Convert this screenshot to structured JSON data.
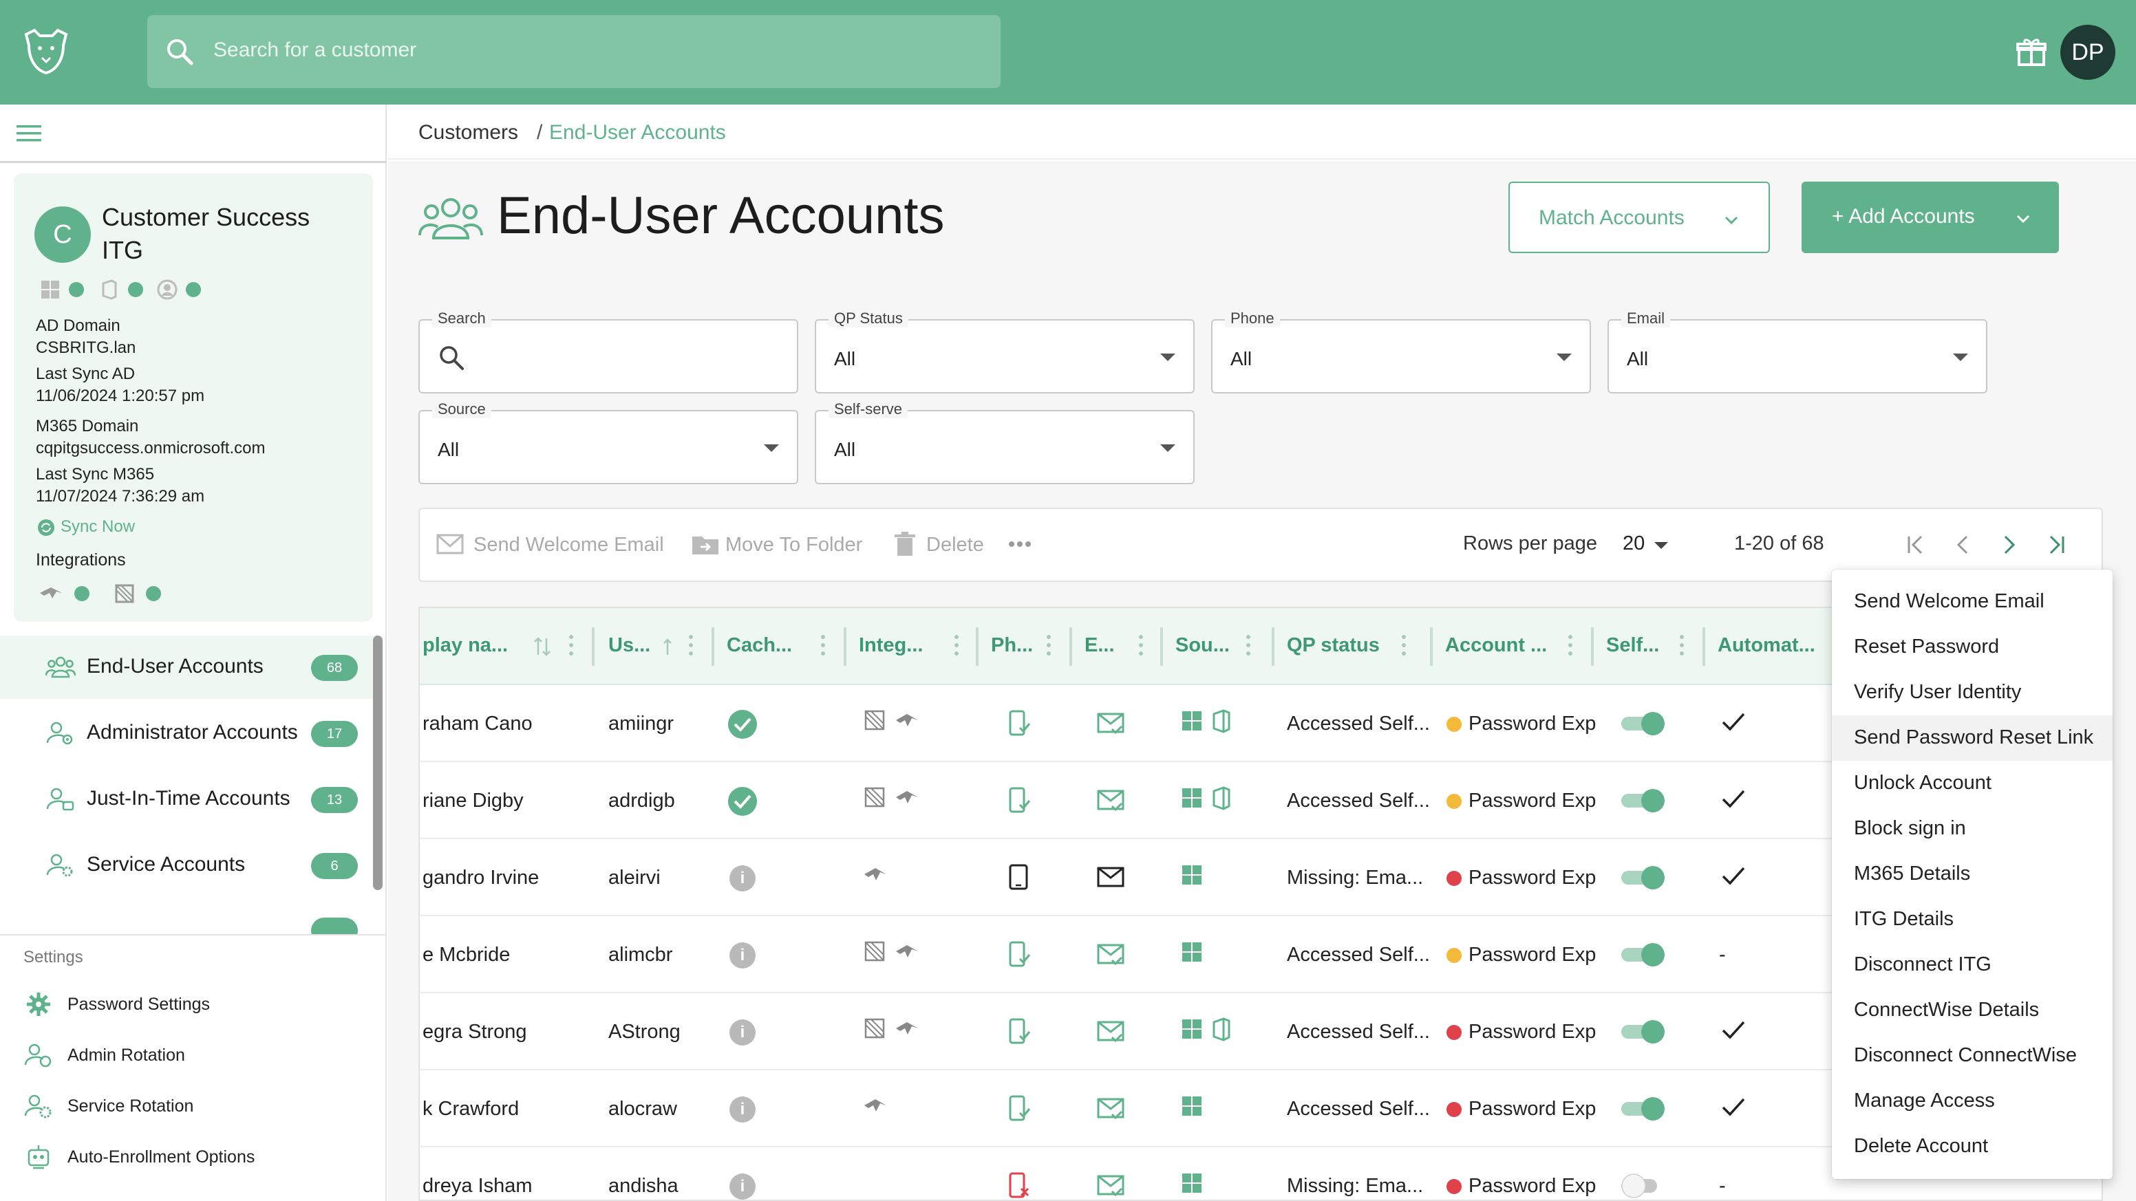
{
  "topbar": {
    "search_placeholder": "Search for a customer",
    "avatar_initials": "DP"
  },
  "customer": {
    "initial": "C",
    "name": "Customer Success ITG",
    "ad_domain_label": "AD Domain",
    "ad_domain": "CSBRITG.lan",
    "last_sync_ad_label": "Last Sync AD",
    "last_sync_ad": "11/06/2024 1:20:57 pm",
    "m365_domain_label": "M365 Domain",
    "m365_domain": "cqpitgsuccess.onmicrosoft.com",
    "last_sync_m365_label": "Last Sync M365",
    "last_sync_m365": "11/07/2024 7:36:29 am",
    "sync_now": "Sync Now",
    "integrations_label": "Integrations"
  },
  "nav": [
    {
      "label": "End-User Accounts",
      "count": "68"
    },
    {
      "label": "Administrator Accounts",
      "count": "17"
    },
    {
      "label": "Just-In-Time Accounts",
      "count": "13"
    },
    {
      "label": "Service Accounts",
      "count": "6"
    }
  ],
  "settings": {
    "label": "Settings",
    "items": [
      "Password Settings",
      "Admin Rotation",
      "Service Rotation",
      "Auto-Enrollment Options"
    ]
  },
  "breadcrumb": {
    "root": "Customers",
    "sep": "/",
    "current": "End-User Accounts"
  },
  "page": {
    "title": "End-User Accounts",
    "match_button": "Match Accounts",
    "add_button": "+ Add Accounts"
  },
  "filters": {
    "search_label": "Search",
    "qp_status": {
      "label": "QP Status",
      "value": "All"
    },
    "phone": {
      "label": "Phone",
      "value": "All"
    },
    "email": {
      "label": "Email",
      "value": "All"
    },
    "source": {
      "label": "Source",
      "value": "All"
    },
    "self_serve": {
      "label": "Self-serve",
      "value": "All"
    }
  },
  "toolbar": {
    "send_welcome": "Send Welcome Email",
    "move_to_folder": "Move To Folder",
    "delete": "Delete",
    "rows_per_page_label": "Rows per page",
    "rows_per_page": "20",
    "range": "1-20 of 68"
  },
  "table": {
    "headers": [
      "play na...",
      "Us...",
      "Cach...",
      "Integ...",
      "Ph...",
      "E...",
      "Sou...",
      "QP status",
      "Account ...",
      "Self...",
      "Automat..."
    ],
    "rows": [
      {
        "name": "raham Cano",
        "user": "amiingr",
        "cached": "check",
        "integ": "both",
        "phone": "ok",
        "qp": "Accessed Self...",
        "status_color": "#f3b93a",
        "account": "Password Exp",
        "self": true,
        "auto": "check",
        "win": true,
        "office": true
      },
      {
        "name": "riane Digby",
        "user": "adrdigb",
        "cached": "check",
        "integ": "both",
        "phone": "ok",
        "qp": "Accessed Self...",
        "status_color": "#f3b93a",
        "account": "Password Exp",
        "self": true,
        "auto": "check",
        "win": true,
        "office": true
      },
      {
        "name": "gandro Irvine",
        "user": "aleirvi",
        "cached": "info",
        "integ": "one",
        "phone": "plain",
        "qp": "Missing: Ema...",
        "status_color": "#e0424b",
        "account": "Password Exp",
        "self": true,
        "auto": "check",
        "win": true,
        "office": false
      },
      {
        "name": "e Mcbride",
        "user": "alimcbr",
        "cached": "info",
        "integ": "both",
        "phone": "ok",
        "qp": "Accessed Self...",
        "status_color": "#f3b93a",
        "account": "Password Exp",
        "self": true,
        "auto": "-",
        "win": true,
        "office": false
      },
      {
        "name": "egra Strong",
        "user": "AStrong",
        "cached": "info",
        "integ": "both",
        "phone": "ok",
        "qp": "Accessed Self...",
        "status_color": "#e0424b",
        "account": "Password Exp",
        "self": true,
        "auto": "check",
        "win": true,
        "office": true
      },
      {
        "name": "k Crawford",
        "user": "alocraw",
        "cached": "info",
        "integ": "one",
        "phone": "ok",
        "qp": "Accessed Self...",
        "status_color": "#e0424b",
        "account": "Password Exp",
        "self": true,
        "auto": "check",
        "win": true,
        "office": false
      },
      {
        "name": "dreya Isham",
        "user": "andisha",
        "cached": "info",
        "integ": "none",
        "phone": "bad",
        "qp": "Missing: Ema...",
        "status_color": "#e0424b",
        "account": "Password Exp",
        "self": false,
        "auto": "-",
        "win": true,
        "office": false
      }
    ]
  },
  "context_menu": [
    "Send Welcome Email",
    "Reset Password",
    "Verify User Identity",
    "Send Password Reset Link",
    "Unlock Account",
    "Block sign in",
    "M365 Details",
    "ITG Details",
    "Disconnect ITG",
    "ConnectWise Details",
    "Disconnect ConnectWise",
    "Manage Access",
    "Delete Account"
  ],
  "colors": {
    "brand": "#5fb28c",
    "warning": "#f3b93a",
    "danger": "#e0424b"
  }
}
